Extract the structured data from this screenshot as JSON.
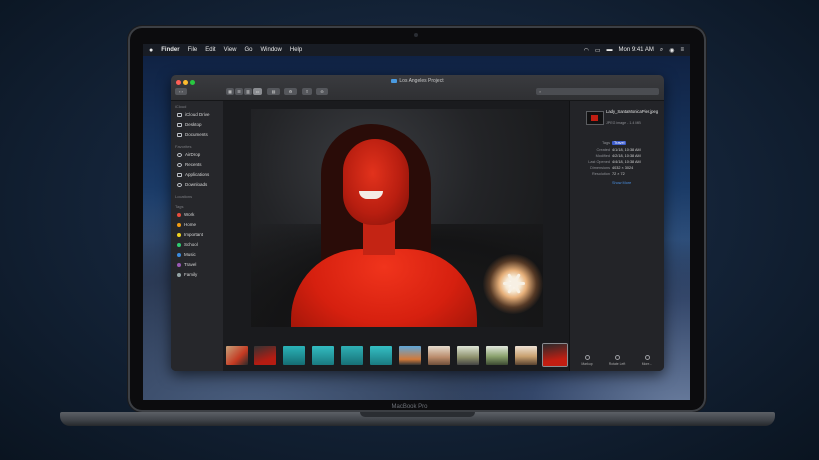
{
  "menubar": {
    "apple": "",
    "items": [
      "Finder",
      "File",
      "Edit",
      "View",
      "Go",
      "Window",
      "Help"
    ],
    "clock": "Mon 9:41 AM"
  },
  "window": {
    "title": "Los Angeles Project",
    "search_placeholder": "",
    "toolbar": [
      "‹ ›",
      "▦",
      "☰",
      "▥",
      "▭",
      "▤",
      "⚙",
      "⇪",
      "⊖"
    ]
  },
  "sidebar": {
    "favorites_header": "iCloud",
    "favorites": [
      "iCloud Drive",
      "Desktop",
      "Documents"
    ],
    "sections_header": "Favorites",
    "locations_items": [
      "AirDrop",
      "Recents",
      "Applications",
      "Downloads"
    ],
    "locations_header": "Locations",
    "tags_header": "Tags",
    "tags": [
      {
        "label": "Work",
        "color": "#e84c3d"
      },
      {
        "label": "Home",
        "color": "#f39c12"
      },
      {
        "label": "Important",
        "color": "#f1d21f"
      },
      {
        "label": "School",
        "color": "#2ecc71"
      },
      {
        "label": "Music",
        "color": "#3a8be0"
      },
      {
        "label": "Travel",
        "color": "#9b59b6"
      },
      {
        "label": "Family",
        "color": "#95a5a6"
      }
    ]
  },
  "inspector": {
    "filename": "Lady_SantaMonicaPier.jpeg",
    "kind": "JPEG image - 1.4 MB",
    "rows": [
      {
        "label": "Tags",
        "value": "Travel"
      },
      {
        "label": "Created",
        "value": "4/1/18, 10:38 AM"
      },
      {
        "label": "Modified",
        "value": "4/2/18, 10:38 AM"
      },
      {
        "label": "Last Opened",
        "value": "4/4/18, 10:38 AM"
      },
      {
        "label": "Dimensions",
        "value": "4032 × 3024"
      },
      {
        "label": "Resolution",
        "value": "72 × 72"
      }
    ],
    "show_more": "Show More",
    "actions": [
      "Markup",
      "Rotate Left",
      "More..."
    ]
  },
  "laptop": {
    "brand": "MacBook Pro"
  },
  "colors": {
    "accent": "#3d5dcc",
    "link": "#4a90e2"
  }
}
